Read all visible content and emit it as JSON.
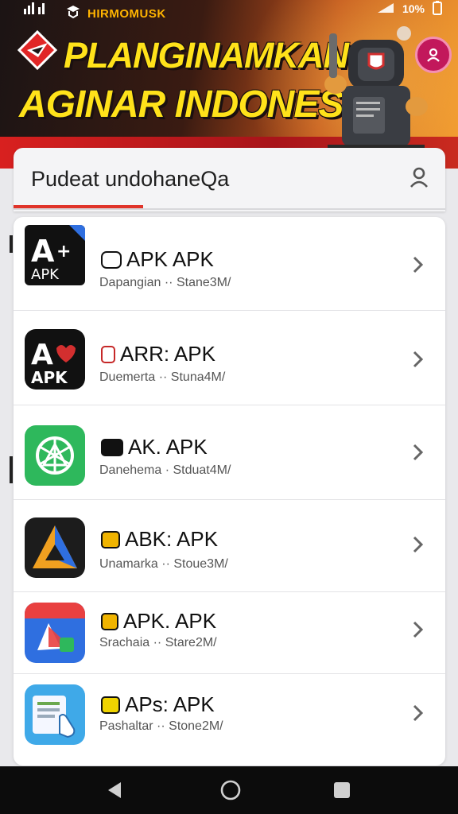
{
  "banner": {
    "brand": "HIRMOMUSK",
    "headline_line1": "PLANGINAMKAN",
    "headline_line2": "AGINAR INDONESIA",
    "status_right": "10%"
  },
  "search": {
    "query": "Pudeat undohaneQa",
    "icon": "person-icon"
  },
  "apps": [
    {
      "title": "APK APK",
      "subtitle": "Dapangian  ··  Stane3M/",
      "icon_bg": "#111111",
      "icon_label": "APK",
      "glyph_color": "#111111"
    },
    {
      "title": "ARR: APK",
      "subtitle": "Duemerta  ··  Stuna4M/",
      "icon_bg": "#111111",
      "icon_label": "APK",
      "glyph_color": "#c62828"
    },
    {
      "title": "AK. APK",
      "subtitle": "Danehema  ·  Stduat4M/",
      "icon_bg": "#2eb85c",
      "icon_label": "",
      "glyph_color": "#111111"
    },
    {
      "title": "ABK: APK",
      "subtitle": "Unamarka  ··  Stoue3M/",
      "icon_bg": "#1c1c1c",
      "icon_label": "",
      "glyph_color": "#f0b400"
    },
    {
      "title": "APK. APK",
      "subtitle": "Srachaia  ··  Stare2M/",
      "icon_bg": "#2f6fe0",
      "icon_label": "",
      "glyph_color": "#f0b400"
    },
    {
      "title": "APs: APK",
      "subtitle": "Pashaltar  ··  Stone2M/",
      "icon_bg": "#3fa9e8",
      "icon_label": "",
      "glyph_color": "#f0d400"
    }
  ],
  "nav": {
    "back": "back-icon",
    "home": "home-icon",
    "recents": "recents-icon"
  },
  "colors": {
    "accent": "#e0342a",
    "banner_red": "#d8201f",
    "headline_yellow": "#ffe21a"
  }
}
